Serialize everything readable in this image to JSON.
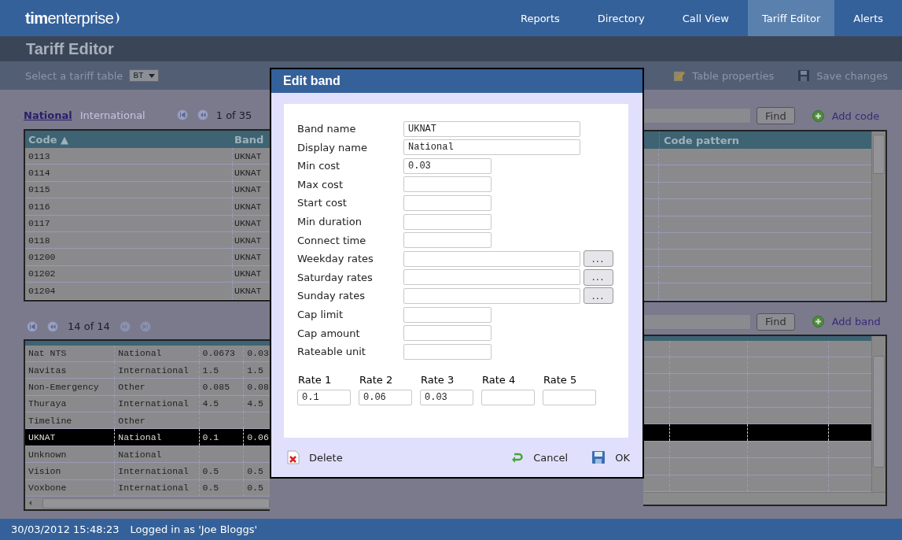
{
  "header": {
    "logo": "**tim**enterprise",
    "nav": [
      {
        "label": "Reports",
        "selected": false
      },
      {
        "label": "Directory",
        "selected": false
      },
      {
        "label": "Call View",
        "selected": false
      },
      {
        "label": "Tariff Editor",
        "selected": true
      },
      {
        "label": "Alerts",
        "selected": false
      }
    ]
  },
  "page_title": "Tariff Editor",
  "toolbar": {
    "table_label": "Select a tariff table",
    "table_value": "BT",
    "actions": [
      {
        "label": "Table properties",
        "kind": "edit"
      },
      {
        "label": "Save changes",
        "kind": "save"
      }
    ]
  },
  "codes": {
    "tabs": [
      {
        "label": "National",
        "selected": true
      },
      {
        "label": "International",
        "selected": false
      }
    ],
    "pager": "1 of 35",
    "find_button": "Find",
    "add_label": "Add code",
    "columns": [
      "Code ▲",
      "Band",
      "Code pattern"
    ],
    "rows": [
      {
        "code": "0113",
        "band": "UKNAT"
      },
      {
        "code": "0114",
        "band": "UKNAT"
      },
      {
        "code": "0115",
        "band": "UKNAT"
      },
      {
        "code": "0116",
        "band": "UKNAT"
      },
      {
        "code": "0117",
        "band": "UKNAT"
      },
      {
        "code": "0118",
        "band": "UKNAT"
      },
      {
        "code": "01200",
        "band": "UKNAT"
      },
      {
        "code": "01202",
        "band": "UKNAT"
      },
      {
        "code": "01204",
        "band": "UKNAT"
      }
    ]
  },
  "bands": {
    "pager": "14 of 14",
    "find_button": "Find",
    "add_label": "Add band",
    "rows": [
      {
        "cells": [
          "Nat NTS",
          "National",
          "0.0673",
          "0.03"
        ],
        "selected": false
      },
      {
        "cells": [
          "Navitas",
          "International",
          "1.5",
          "1.5"
        ],
        "selected": false
      },
      {
        "cells": [
          "Non-Emergency",
          "Other",
          "0.085",
          "0.08"
        ],
        "selected": false
      },
      {
        "cells": [
          "Thuraya",
          "International",
          "4.5",
          "4.5"
        ],
        "selected": false
      },
      {
        "cells": [
          "Timeline",
          "Other"
        ],
        "selected": false
      },
      {
        "cells": [
          "UKNAT",
          "National",
          "0.1",
          "0.06"
        ],
        "selected": true
      },
      {
        "cells": [
          "Unknown",
          "National"
        ],
        "selected": false
      },
      {
        "cells": [
          "Vision",
          "International",
          "0.5",
          "0.5"
        ],
        "selected": false
      },
      {
        "cells": [
          "Voxbone",
          "International",
          "0.5",
          "0.5"
        ],
        "selected": false
      }
    ]
  },
  "dialog": {
    "title": "Edit band",
    "fields": [
      {
        "label": "Band name",
        "value": "UKNAT",
        "kind": "wide"
      },
      {
        "label": "Display name",
        "value": "National",
        "kind": "wide"
      },
      {
        "label": "Min cost",
        "value": "0.03",
        "kind": "short"
      },
      {
        "label": "Max cost",
        "kind": "short"
      },
      {
        "label": "Start cost",
        "kind": "short"
      },
      {
        "label": "Min duration",
        "kind": "short"
      },
      {
        "label": "Connect time",
        "kind": "short"
      },
      {
        "label": "Weekday rates",
        "kind": "picker",
        "button": "..."
      },
      {
        "label": "Saturday rates",
        "kind": "picker",
        "button": "..."
      },
      {
        "label": "Sunday rates",
        "kind": "picker",
        "button": "..."
      },
      {
        "label": "Cap limit",
        "kind": "short"
      },
      {
        "label": "Cap amount",
        "kind": "short"
      },
      {
        "label": "Rateable unit",
        "kind": "short"
      }
    ],
    "rates": [
      {
        "label": "Rate 1",
        "value": "0.1"
      },
      {
        "label": "Rate 2",
        "value": "0.06"
      },
      {
        "label": "Rate 3",
        "value": "0.03"
      },
      {
        "label": "Rate 4"
      },
      {
        "label": "Rate 5"
      }
    ],
    "buttons": [
      {
        "label": "Delete",
        "kind": "delete"
      },
      {
        "label": "Cancel",
        "kind": "cancel"
      },
      {
        "label": "OK",
        "kind": "ok"
      }
    ]
  },
  "status": {
    "timestamp": "30/03/2012 15:48:23",
    "user": "Logged in as 'Joe Bloggs'"
  }
}
